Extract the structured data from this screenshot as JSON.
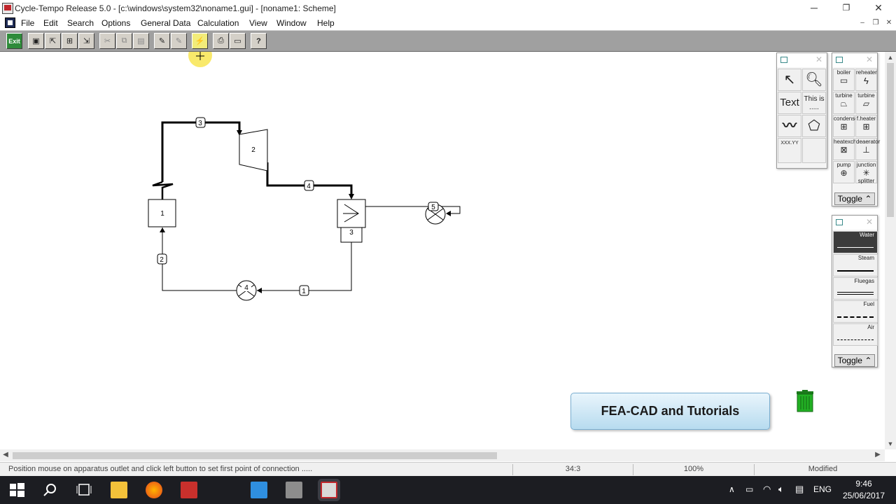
{
  "window": {
    "title": "Cycle-Tempo Release 5.0 - [c:\\windows\\system32\\noname1.gui] - [noname1: Scheme]",
    "minimize": "─",
    "restore": "❐",
    "close": "✕"
  },
  "menu": {
    "items": [
      "File",
      "Edit",
      "Search",
      "Options",
      "General Data",
      "Calculation",
      "View",
      "Window",
      "Help"
    ],
    "mdi_minimize": "–",
    "mdi_restore": "❐",
    "mdi_close": "✕"
  },
  "toolbar": {
    "exit_label": "Exit",
    "help_label": "?"
  },
  "scheme": {
    "apparatus": [
      {
        "id": "boiler",
        "label": "1"
      },
      {
        "id": "turbine",
        "label": "2"
      },
      {
        "id": "condenser",
        "label": "3"
      },
      {
        "id": "pump-main",
        "label": "4"
      },
      {
        "id": "pump-cooling",
        "label": "5"
      }
    ],
    "pipes": [
      "1",
      "2",
      "3",
      "4"
    ]
  },
  "palette_tools": {
    "text_label": "Text",
    "this_is_label": "This is .....",
    "xxx_label": "XXX.YY"
  },
  "palette_apparatus": {
    "items": [
      [
        "boiler",
        "reheater"
      ],
      [
        "turbine",
        "turbine"
      ],
      [
        "condenser",
        "f.heater"
      ],
      [
        "heatexch",
        "deaerator"
      ],
      [
        "pump",
        "junction"
      ],
      [
        "",
        "splitter"
      ]
    ],
    "toggle": "Toggle"
  },
  "palette_media": {
    "items": [
      "Water",
      "Steam",
      "Fluegas",
      "Fuel",
      "Air"
    ],
    "toggle": "Toggle"
  },
  "banner": "FEA-CAD and Tutorials",
  "statusbar": {
    "message": "Position mouse on apparatus outlet and click left button to set first point of connection .....",
    "coords": "34:3",
    "zoom": "100%",
    "state": "Modified"
  },
  "taskbar": {
    "lang": "ENG",
    "time": "9:46",
    "date": "25/06/2017"
  },
  "colors": {
    "toolbar_bg": "#a0a0a0",
    "banner_accent": "#b7dbef",
    "trash": "#22b024",
    "highlight_cursor": "#f7e23a"
  }
}
